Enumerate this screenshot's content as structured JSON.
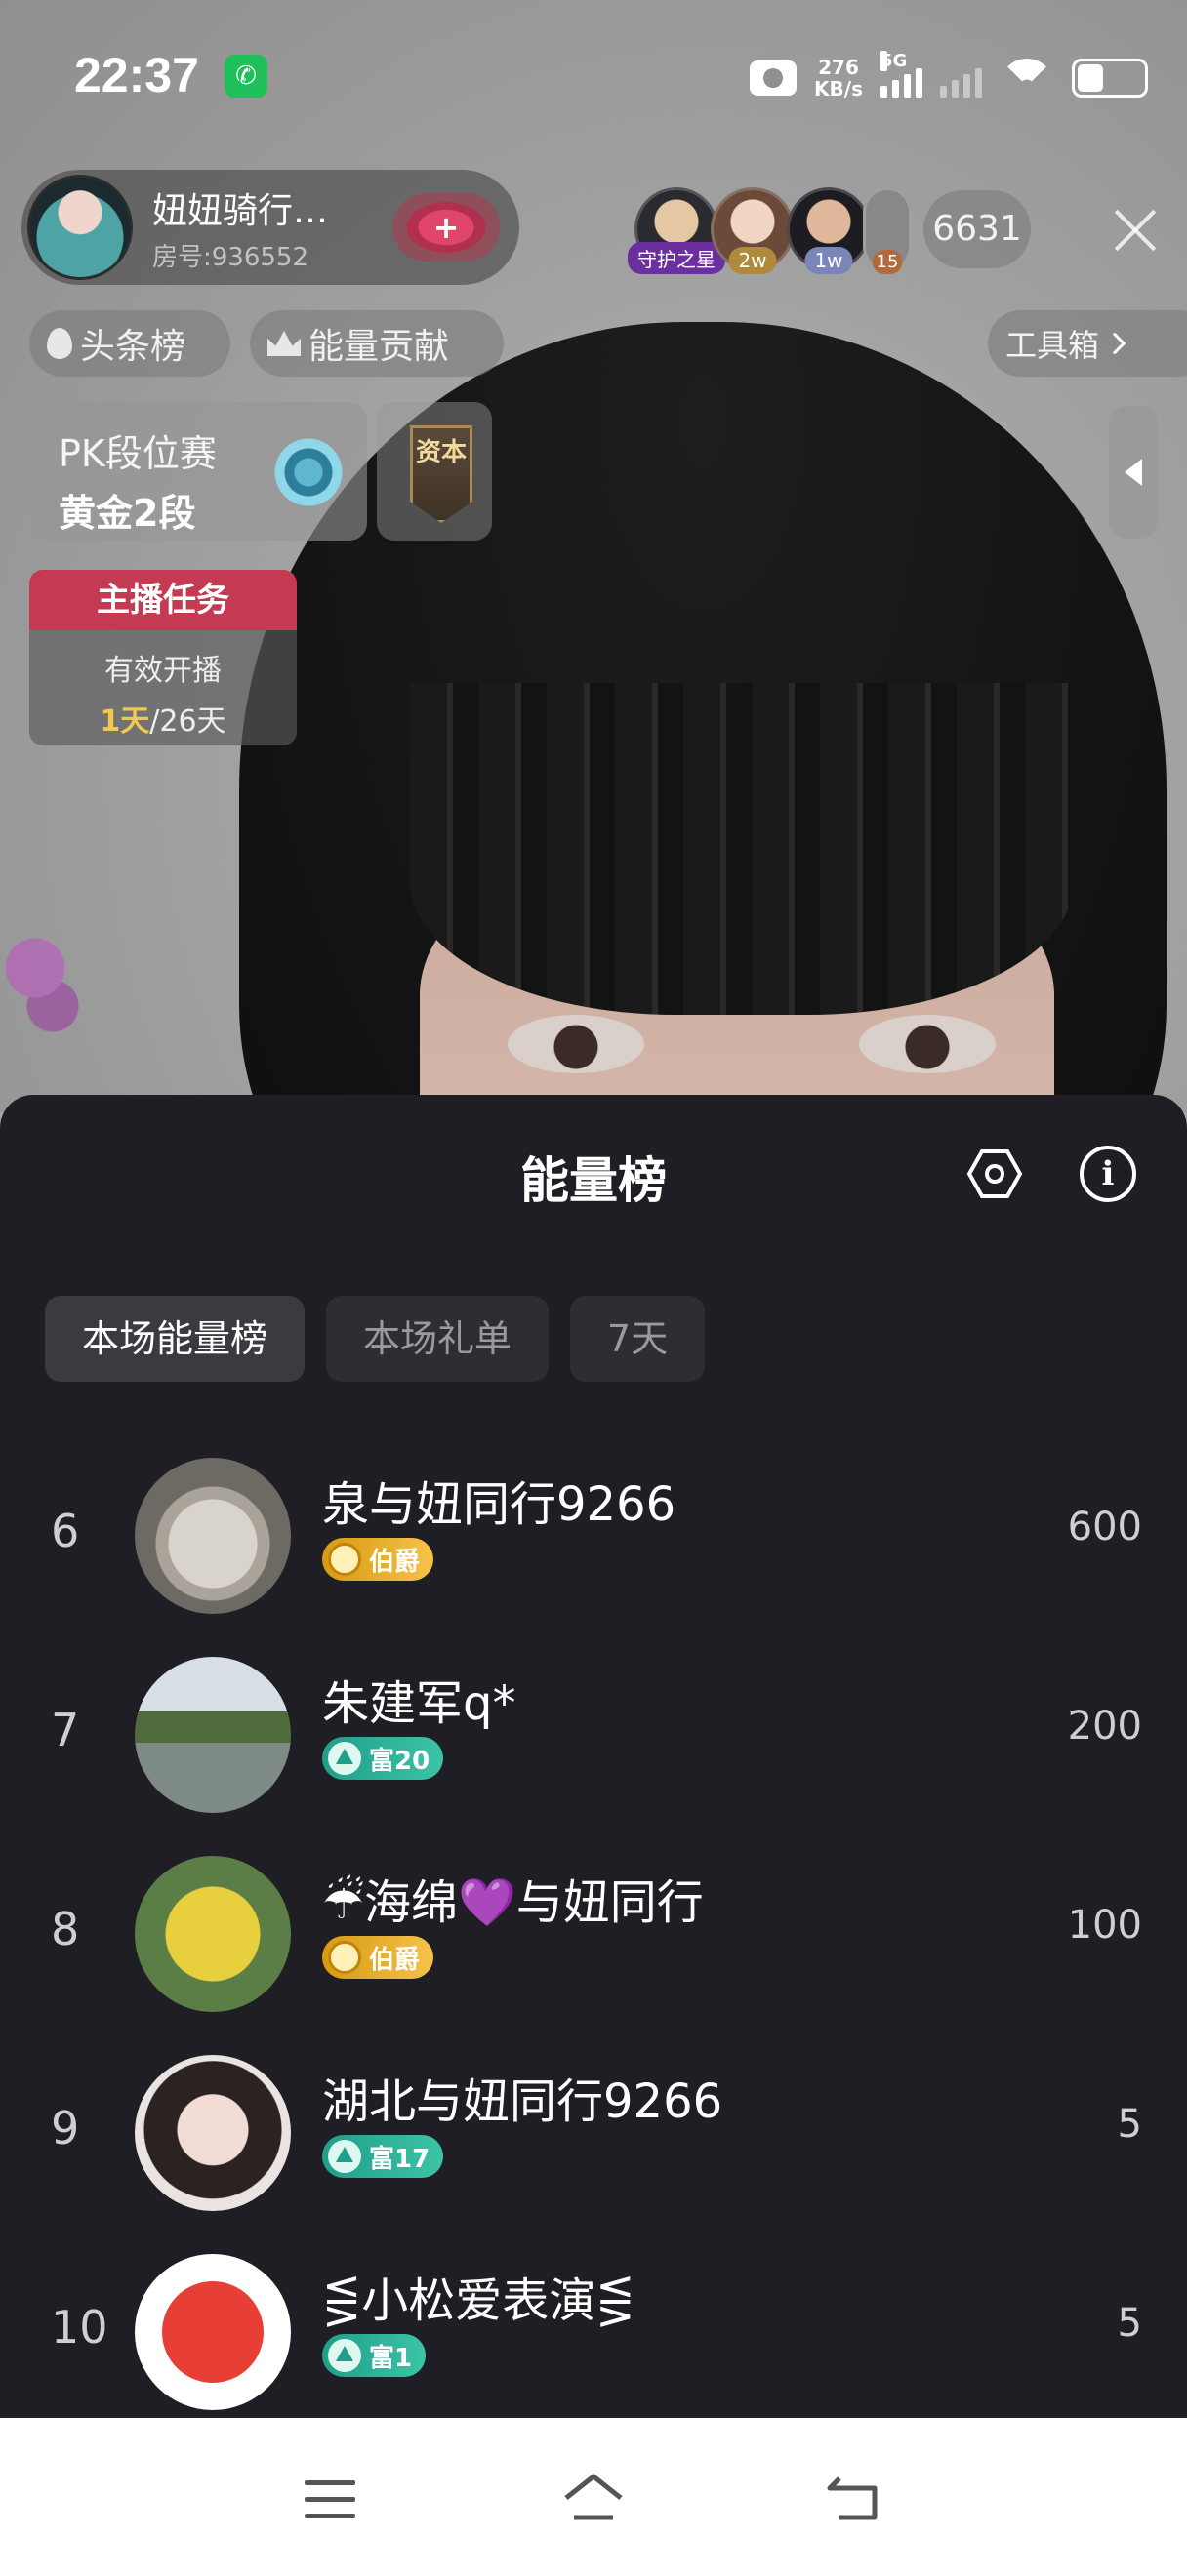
{
  "status_bar": {
    "time": "22:37",
    "net_speed_value": "276",
    "net_speed_unit": "KB/s",
    "network": "5G"
  },
  "host": {
    "name": "妞妞骑行…",
    "room": "房号:936552",
    "follow_symbol": "+"
  },
  "viewers": {
    "badges": [
      "守护之星",
      "2w",
      "1w",
      "15"
    ],
    "count": "6631"
  },
  "pills": {
    "headline": "头条榜",
    "energy": "能量贡献",
    "tools": "工具箱"
  },
  "pk": {
    "title": "PK段位赛",
    "rank": "黄金2段",
    "asset": "资本"
  },
  "task": {
    "title": "主播任务",
    "label": "有效开播",
    "progress_current": "1天",
    "progress_total": "/26天"
  },
  "sheet": {
    "title": "能量榜",
    "tabs": [
      "本场能量榜",
      "本场礼单",
      "7天"
    ],
    "active_tab": 0,
    "rows": [
      {
        "rank": "6",
        "name": "泉与妞同行9266",
        "badge": "伯爵",
        "score": "600"
      },
      {
        "rank": "7",
        "name": "朱建军q*",
        "badge": "富20",
        "score": "200"
      },
      {
        "rank": "8",
        "name": "☔海绵💜与妞同行",
        "badge": "伯爵",
        "score": "100"
      },
      {
        "rank": "9",
        "name": "湖北与妞同行9266",
        "badge": "富17",
        "score": "5"
      },
      {
        "rank": "10",
        "name": "⋚小松爱表演⋚",
        "badge": "富1",
        "score": "5"
      }
    ]
  },
  "colors": {
    "sheet_bg": "#1f1e24",
    "task_header": "#c43a52",
    "badge_gold": "#f5c24a",
    "badge_teal": "#3cc4a6"
  }
}
